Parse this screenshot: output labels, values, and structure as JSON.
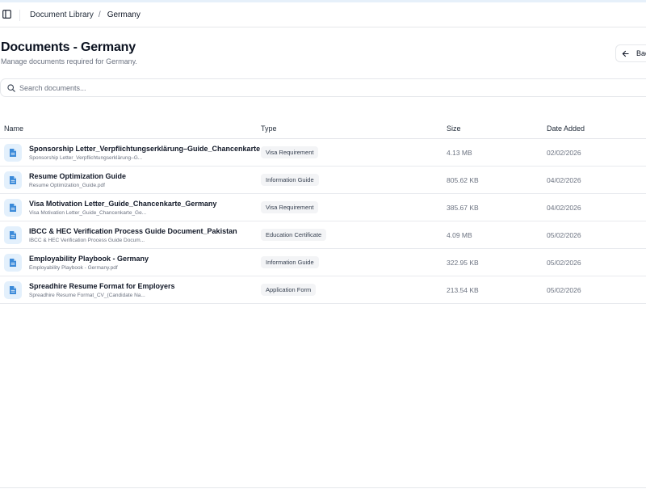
{
  "breadcrumb": {
    "root": "Document Library",
    "separator": "/",
    "current": "Germany"
  },
  "page": {
    "title": "Documents - Germany",
    "subtitle": "Manage documents required for Germany.",
    "back_label": "Back"
  },
  "search": {
    "placeholder": "Search documents...",
    "value": ""
  },
  "table": {
    "headers": {
      "name": "Name",
      "type": "Type",
      "size": "Size",
      "date": "Date Added"
    },
    "rows": [
      {
        "title": "Sponsorship Letter_Verpflichtungserklärung–Guide_Chancenkarte",
        "file": "Sponsorship Letter_Verpflichtungserklärung–G...",
        "type": "Visa Requirement",
        "size": "4.13 MB",
        "date": "02/02/2026"
      },
      {
        "title": "Resume Optimization Guide",
        "file": "Resume Optimization_Guide.pdf",
        "type": "Information Guide",
        "size": "805.62 KB",
        "date": "04/02/2026"
      },
      {
        "title": "Visa Motivation Letter_Guide_Chancenkarte_Germany",
        "file": "Visa Motivation Letter_Guide_Chancenkarte_Ge...",
        "type": "Visa Requirement",
        "size": "385.67 KB",
        "date": "04/02/2026"
      },
      {
        "title": "IBCC & HEC Verification Process Guide Document_Pakistan",
        "file": "IBCC & HEC Verification Process Guide Docum...",
        "type": "Education Certificate",
        "size": "4.09 MB",
        "date": "05/02/2026"
      },
      {
        "title": "Employability Playbook - Germany",
        "file": "Employability Playbook - Germany.pdf",
        "type": "Information Guide",
        "size": "322.95 KB",
        "date": "05/02/2026"
      },
      {
        "title": "Spreadhire Resume Format for Employers",
        "file": "Spreadhire Resume Format_CV_(Candidate Na...",
        "type": "Application Form",
        "size": "213.54 KB",
        "date": "05/02/2026"
      }
    ]
  },
  "colors": {
    "file_icon_bg": "#e3f0fc",
    "file_icon_fg": "#3b8ad9",
    "badge_bg": "#f3f4f6",
    "border": "#e5e7eb"
  },
  "icons": {
    "sidebar_toggle": "sidebar-toggle-icon",
    "back": "arrow-left-icon",
    "search": "search-icon",
    "file": "file-text-icon"
  }
}
